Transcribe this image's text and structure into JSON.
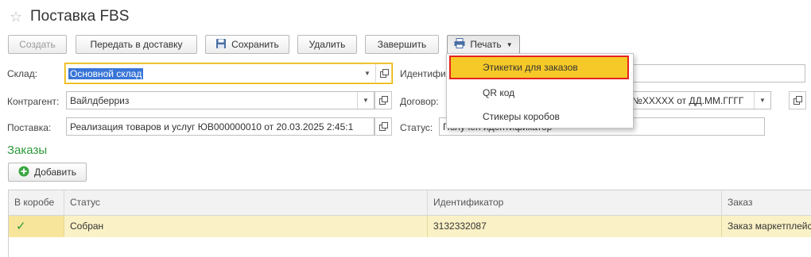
{
  "header": {
    "title": "Поставка FBS",
    "favorite_icon": "star-icon"
  },
  "toolbar": {
    "create": "Создать",
    "transfer": "Передать в доставку",
    "save": "Сохранить",
    "delete": "Удалить",
    "finish": "Завершить",
    "print": "Печать"
  },
  "form": {
    "warehouse_label": "Склад:",
    "warehouse_value": "Основной склад",
    "identifier_label": "Идентифи",
    "counterparty_label": "Контрагент:",
    "counterparty_value": "Вайлдберриз",
    "contract_label": "Договор:",
    "contract_value": "№XXXXX от ДД.ММ.ГГГГ",
    "supply_label": "Поставка:",
    "supply_value": "Реализация товаров и услуг ЮВ000000010 от 20.03.2025 2:45:1",
    "status_label": "Статус:",
    "status_value": "Получен идентификатор"
  },
  "orders": {
    "section_title": "Заказы",
    "add_button": "Добавить",
    "columns": [
      "В коробе",
      "Статус",
      "Идентификатор",
      "Заказ"
    ],
    "rows": [
      {
        "in_box": "✓",
        "status": "Собран",
        "identifier": "3132332087",
        "order": "Заказ маркетплейса"
      }
    ]
  },
  "print_menu": {
    "items": [
      "Этикетки для заказов",
      "QR код",
      "Стикеры коробов"
    ],
    "active_index": 0
  },
  "colors": {
    "accent_green": "#2f9a3b",
    "highlight": "#f7c928",
    "outline_red": "#e3231e",
    "row_selected": "#fbf1c6"
  }
}
